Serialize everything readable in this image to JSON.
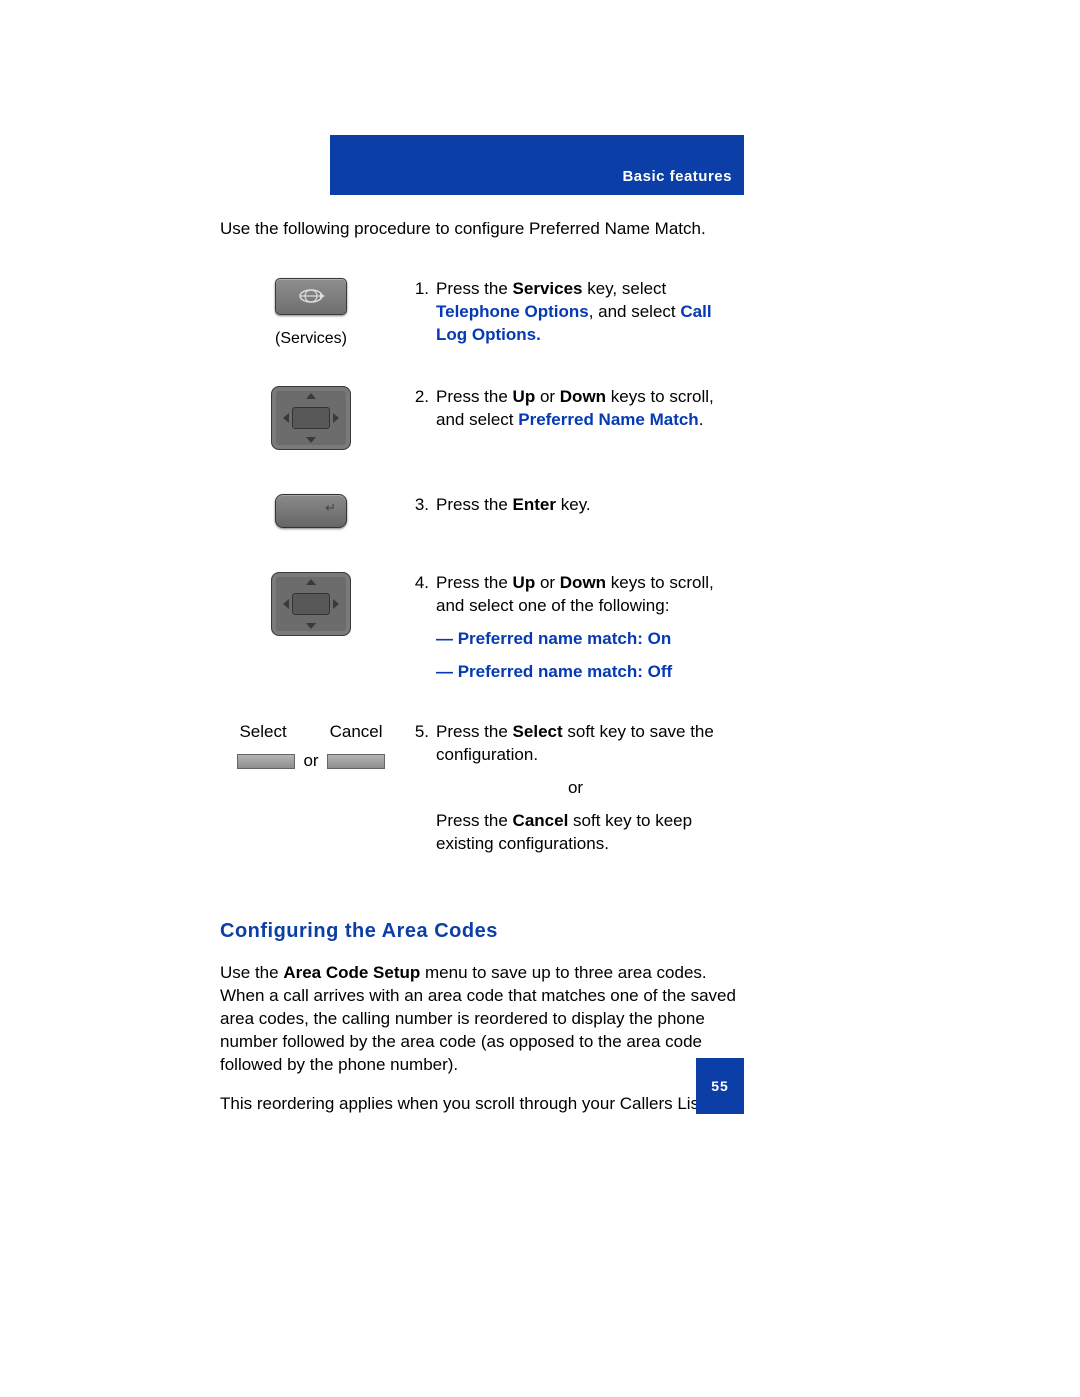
{
  "header": {
    "section_label": "Basic features"
  },
  "intro": "Use the following procedure to configure Preferred Name Match.",
  "steps": {
    "s1": {
      "num": "1.",
      "icon_caption": "(Services)",
      "t1": "Press the ",
      "k1": "Services",
      "t2": " key, select ",
      "k2": "Telephone Options",
      "t3": ", and select ",
      "k3": "Call Log Options."
    },
    "s2": {
      "num": "2.",
      "t1": "Press the ",
      "k1": "Up",
      "t2": " or ",
      "k2": "Down",
      "t3": " keys to scroll, and select ",
      "k3": "Preferred Name Match",
      "t4": "."
    },
    "s3": {
      "num": "3.",
      "t1": "Press the ",
      "k1": "Enter",
      "t2": " key."
    },
    "s4": {
      "num": "4.",
      "t1": "Press the ",
      "k1": "Up",
      "t2": " or ",
      "k2": "Down",
      "t3": " keys to scroll, and select one of the following:",
      "opts": {
        "a": "—   Preferred name match: On",
        "b": "—   Preferred name match: Off"
      }
    },
    "s5": {
      "num": "5.",
      "sk_select": "Select",
      "sk_cancel": "Cancel",
      "sk_or": "or",
      "t1": "Press the ",
      "k1": "Select",
      "t2": " soft key to save the configuration.",
      "mid_or": "or",
      "t3": "Press the ",
      "k2": "Cancel",
      "t4": " soft key to keep existing configurations."
    }
  },
  "section2": {
    "heading": "Configuring the Area Codes",
    "p1a": "Use the ",
    "p1k": "Area Code Setup",
    "p1b": " menu to save up to three area codes. When a call arrives with an area code that matches one of the saved area codes, the calling number is reordered to display the phone number followed by the area code (as opposed to the area code followed by the phone number).",
    "p2": "This reordering applies when you scroll through your Callers List."
  },
  "page_number": "55"
}
